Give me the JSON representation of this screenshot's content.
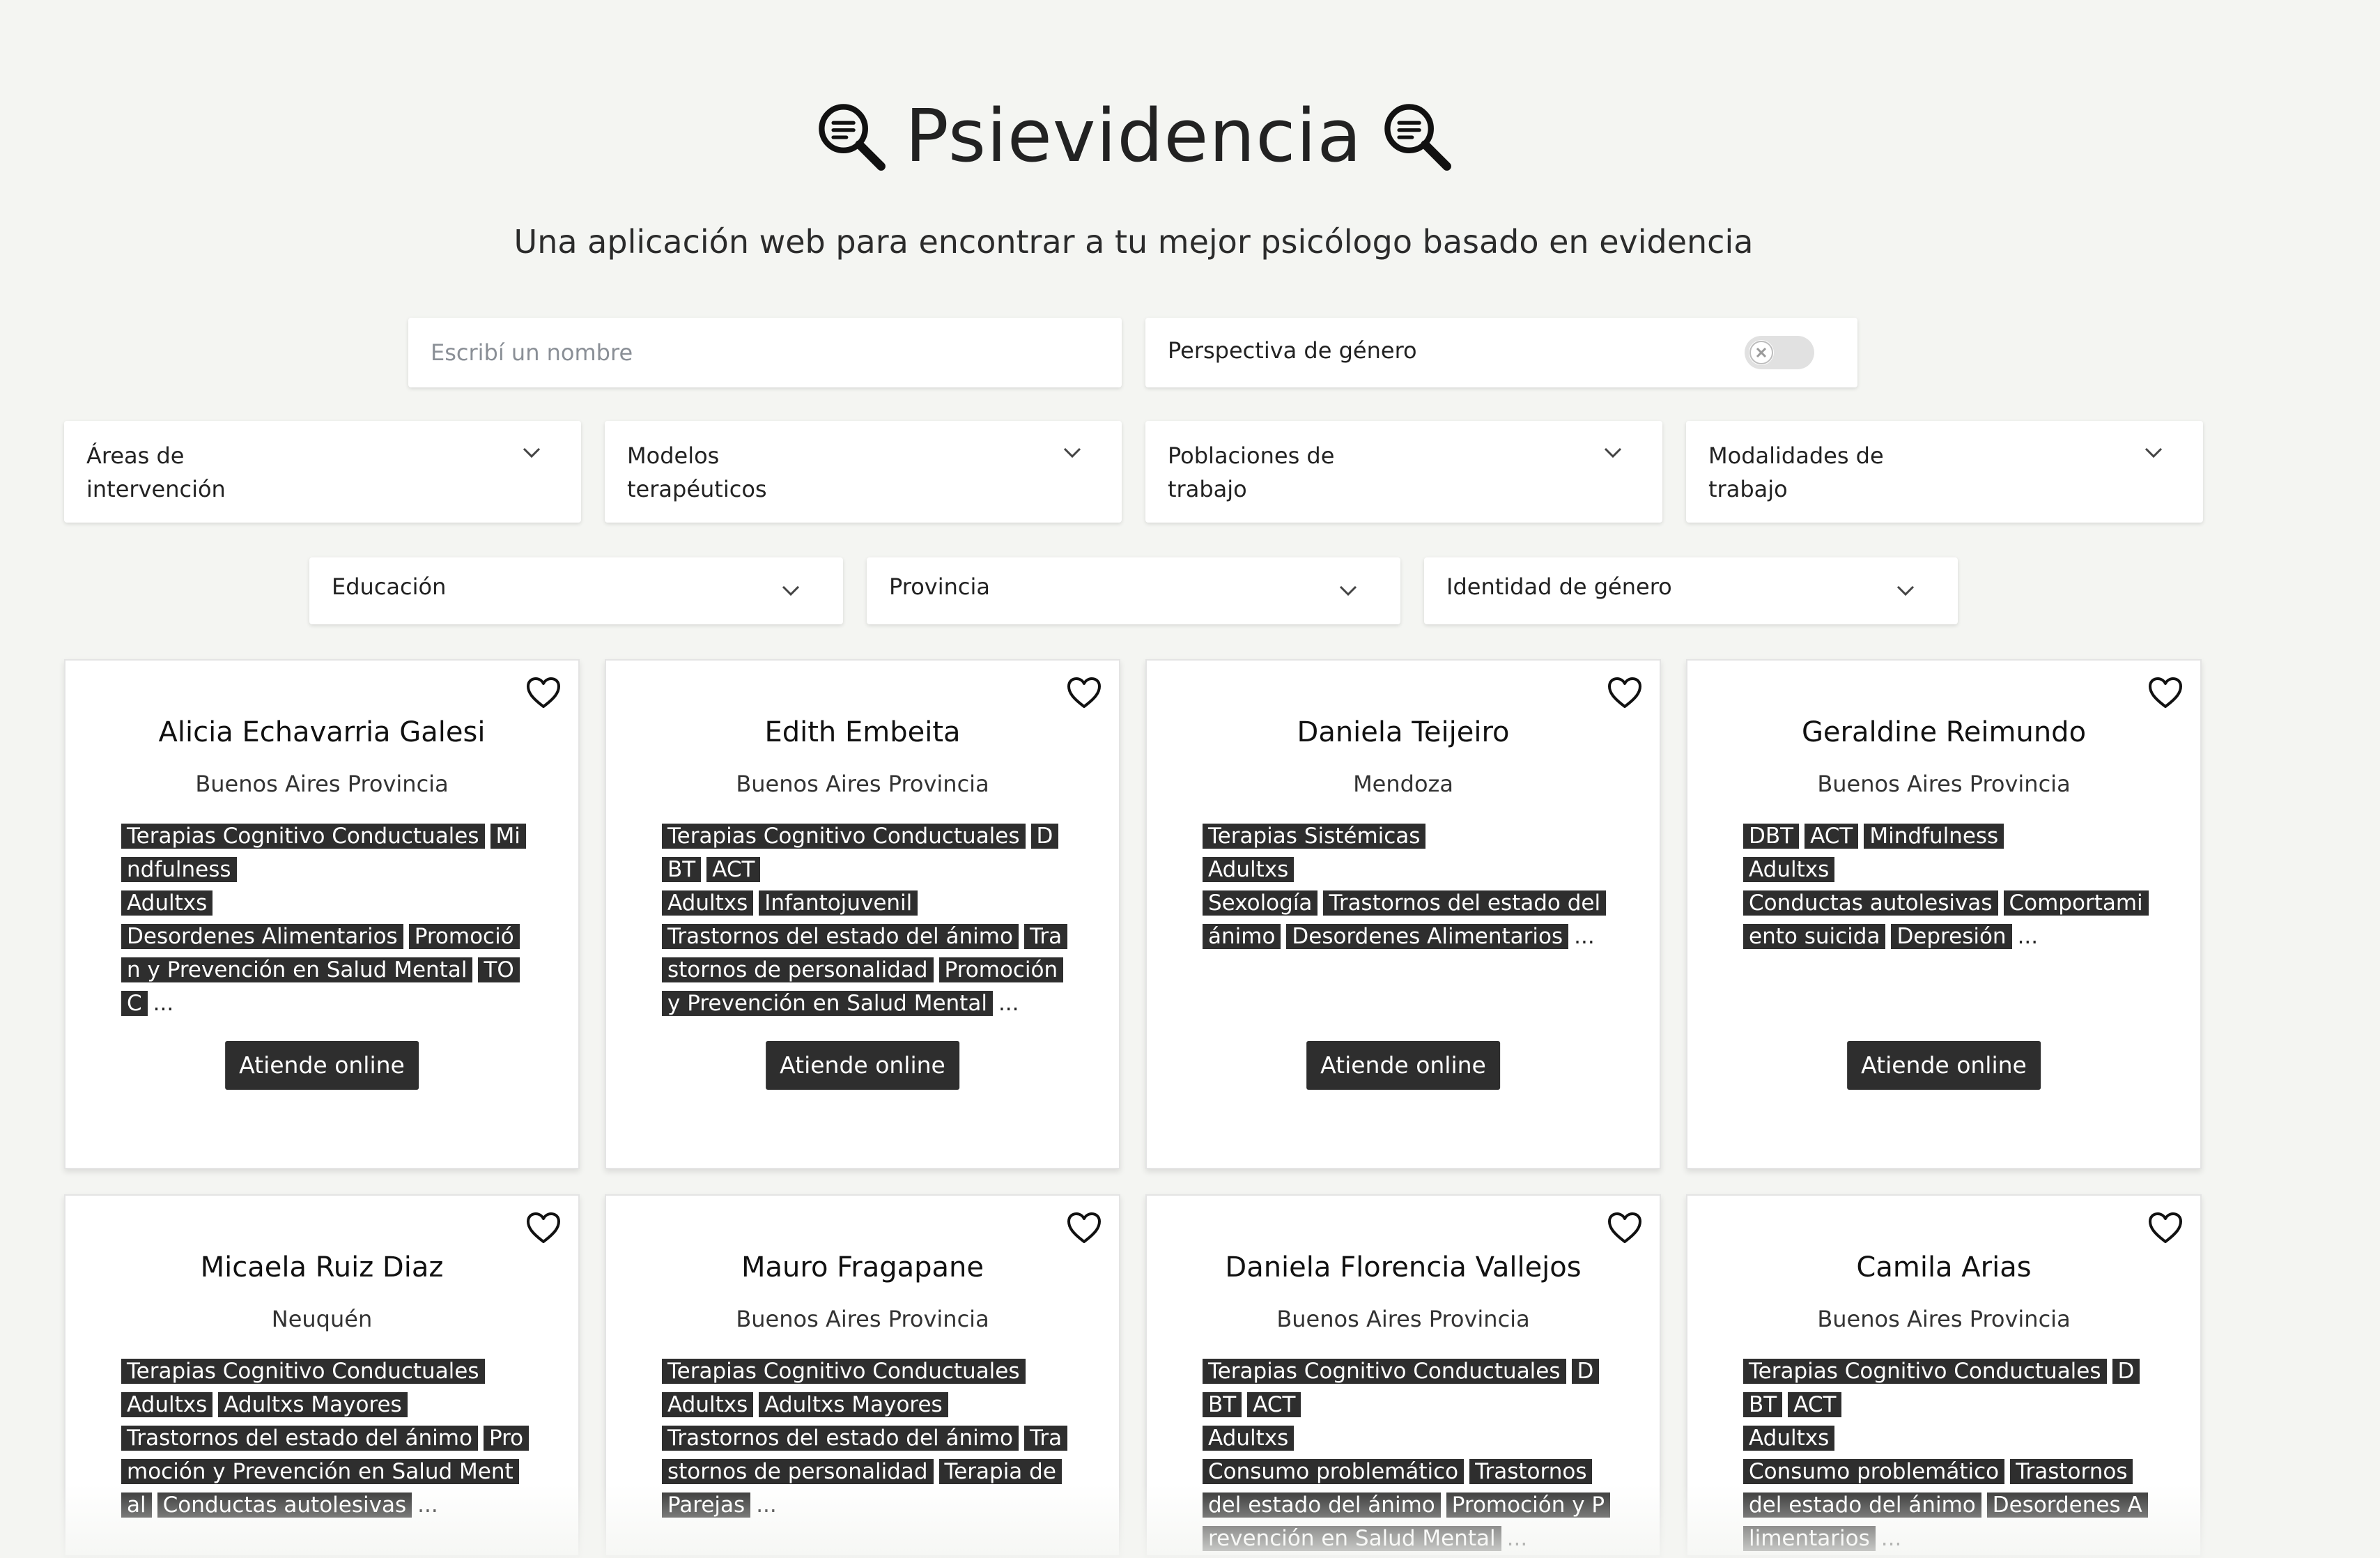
{
  "app": {
    "title": "Psievidencia",
    "subtitle": "Una aplicación web para encontrar a tu mejor psicólogo basado en evidencia",
    "title_icon": "magnifier-document-icon"
  },
  "search": {
    "placeholder": "Escribí un nombre",
    "value": ""
  },
  "gender_toggle": {
    "label": "Perspectiva de género",
    "on": false
  },
  "filters": {
    "areas": "Áreas de intervención",
    "modelos": "Modelos terapéuticos",
    "poblaciones": "Poblaciones de trabajo",
    "modalidades": "Modalidades de trabajo",
    "educacion": "Educación",
    "provincia": "Provincia",
    "identidad": "Identidad de género"
  },
  "cards": [
    {
      "name": "Alicia Echavarria Galesi",
      "province": "Buenos Aires Provincia",
      "tags": [
        [
          "Terapias Cognitivo Conductuales",
          "Mindfulness"
        ],
        [
          "Adultxs"
        ],
        [
          "Desordenes Alimentarios",
          "Promoción y Prevención en Salud Mental",
          "TOC"
        ]
      ],
      "button": "Atiende online"
    },
    {
      "name": "Edith Embeita",
      "province": "Buenos Aires Provincia",
      "tags": [
        [
          "Terapias Cognitivo Conductuales",
          "DBT",
          "ACT"
        ],
        [
          "Adultxs",
          "Infantojuvenil"
        ],
        [
          "Trastornos del estado del ánimo",
          "Trastornos de personalidad",
          "Promoción y Prevención en Salud Mental"
        ]
      ],
      "button": "Atiende online"
    },
    {
      "name": "Daniela Teijeiro",
      "province": "Mendoza",
      "tags": [
        [
          "Terapias Sistémicas"
        ],
        [
          "Adultxs"
        ],
        [
          "Sexología",
          "Trastornos del estado del ánimo",
          "Desordenes Alimentarios"
        ]
      ],
      "button": "Atiende online"
    },
    {
      "name": "Geraldine Reimundo",
      "province": "Buenos Aires Provincia",
      "tags": [
        [
          "DBT",
          "ACT",
          "Mindfulness"
        ],
        [
          "Adultxs"
        ],
        [
          "Conductas autolesivas",
          "Comportamiento suicida",
          "Depresión"
        ]
      ],
      "button": "Atiende online"
    },
    {
      "name": "Micaela Ruiz Diaz",
      "province": "Neuquén",
      "tags": [
        [
          "Terapias Cognitivo Conductuales"
        ],
        [
          "Adultxs",
          "Adultxs Mayores"
        ],
        [
          "Trastornos del estado del ánimo",
          "Promoción y Prevención en Salud Mental",
          "Conductas autolesivas"
        ]
      ],
      "button": ""
    },
    {
      "name": "Mauro Fragapane",
      "province": "Buenos Aires Provincia",
      "tags": [
        [
          "Terapias Cognitivo Conductuales"
        ],
        [
          "Adultxs",
          "Adultxs Mayores"
        ],
        [
          "Trastornos del estado del ánimo",
          "Trastornos de personalidad",
          "Terapia de Parejas"
        ]
      ],
      "button": ""
    },
    {
      "name": "Daniela Florencia Vallejos",
      "province": "Buenos Aires Provincia",
      "tags": [
        [
          "Terapias Cognitivo Conductuales",
          "DBT",
          "ACT"
        ],
        [
          "Adultxs"
        ],
        [
          "Consumo problemático",
          "Trastornos del estado del ánimo",
          "Promoción y Prevención en Salud Mental"
        ]
      ],
      "button": ""
    },
    {
      "name": "Camila Arias",
      "province": "Buenos Aires Provincia",
      "tags": [
        [
          "Terapias Cognitivo Conductuales",
          "DBT",
          "ACT"
        ],
        [
          "Adultxs"
        ],
        [
          "Consumo problemático",
          "Trastornos del estado del ánimo",
          "Desordenes Alimentarios"
        ]
      ],
      "button": ""
    }
  ],
  "ellipsis": "..."
}
